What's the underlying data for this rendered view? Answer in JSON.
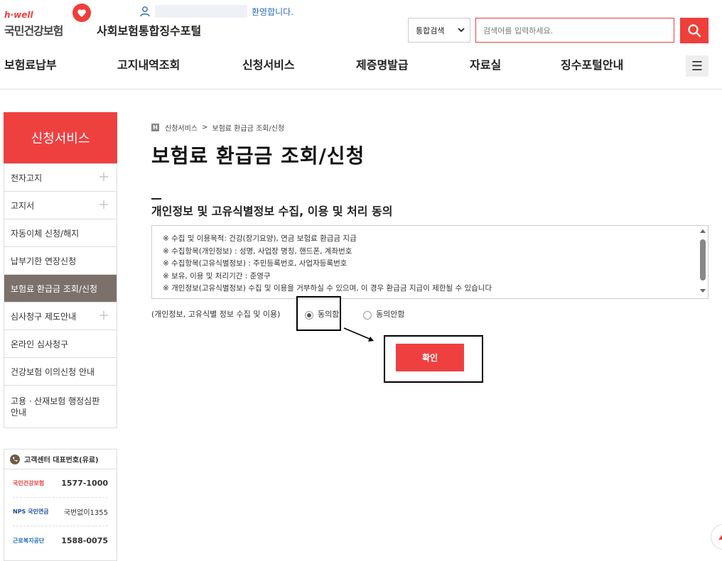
{
  "header": {
    "logo_tagline": "h·well",
    "logo_name": "국민건강보험",
    "portal_title": "사회보험통합징수포털",
    "welcome": "환영합니다.",
    "search_scope": "통합검색",
    "search_placeholder": "검색어를 입력하세요."
  },
  "gnb": [
    "보험료납부",
    "고지내역조회",
    "신청서비스",
    "제증명발급",
    "자료실",
    "징수포털안내"
  ],
  "sidebar": {
    "title": "신청서비스",
    "items": [
      {
        "label": "전자고지",
        "expandable": true
      },
      {
        "label": "고지서",
        "expandable": true
      },
      {
        "label": "자동이체 신청/해지",
        "expandable": false
      },
      {
        "label": "납부기한 연장신청",
        "expandable": false
      },
      {
        "label": "보험료 환급금 조회/신청",
        "expandable": false,
        "active": true
      },
      {
        "label": "심사청구 제도안내",
        "expandable": true
      },
      {
        "label": "온라인 심사청구",
        "expandable": false
      },
      {
        "label": "건강보험 이의신청 안내",
        "expandable": false
      },
      {
        "label": "고용ㆍ산재보험 행정심판 안내",
        "expandable": false
      }
    ]
  },
  "customer_center": {
    "title": "고객센터 대표번호(유료)",
    "rows": [
      {
        "org": "국민건강보험",
        "number": "1577-1000"
      },
      {
        "org": "NPS 국민연금",
        "number": "국번없이1355"
      },
      {
        "org": "근로복지공단",
        "number": "1588-0075"
      }
    ]
  },
  "breadcrumb": {
    "home": "H",
    "items": [
      "신청서비스",
      "보험료 환급금 조회/신청"
    ],
    "separator": ">"
  },
  "main": {
    "page_title": "보험료 환급금 조회/신청",
    "section_title": "개인정보 및 고유식별정보 수집, 이용 및 처리 동의",
    "terms": [
      "※ 수집 및 이용목적: 건강(장기요양), 연금 보험료 환급금 지급",
      "※ 수집항목(개인정보) : 성명, 사업장 명칭, 핸드폰, 계좌번호",
      "※ 수집항목(고유식별정보) : 주민등록번호, 사업자등록번호",
      "※ 보유, 이용 및 처리기간 : 준영구",
      "※ 개인정보(고유식별정보) 수집 및 이용을 거부하실 수 있으며, 이 경우 환급금 지급이 제한될 수 있습니다"
    ],
    "consent_label": "(개인정보, 고유식별 정보 수집 및 이용)",
    "agree": "동의함",
    "disagree": "동의안함",
    "selected": "agree",
    "confirm": "확인"
  },
  "colors": {
    "brand_red": "#ef4040",
    "active_menu": "#7c706b"
  }
}
